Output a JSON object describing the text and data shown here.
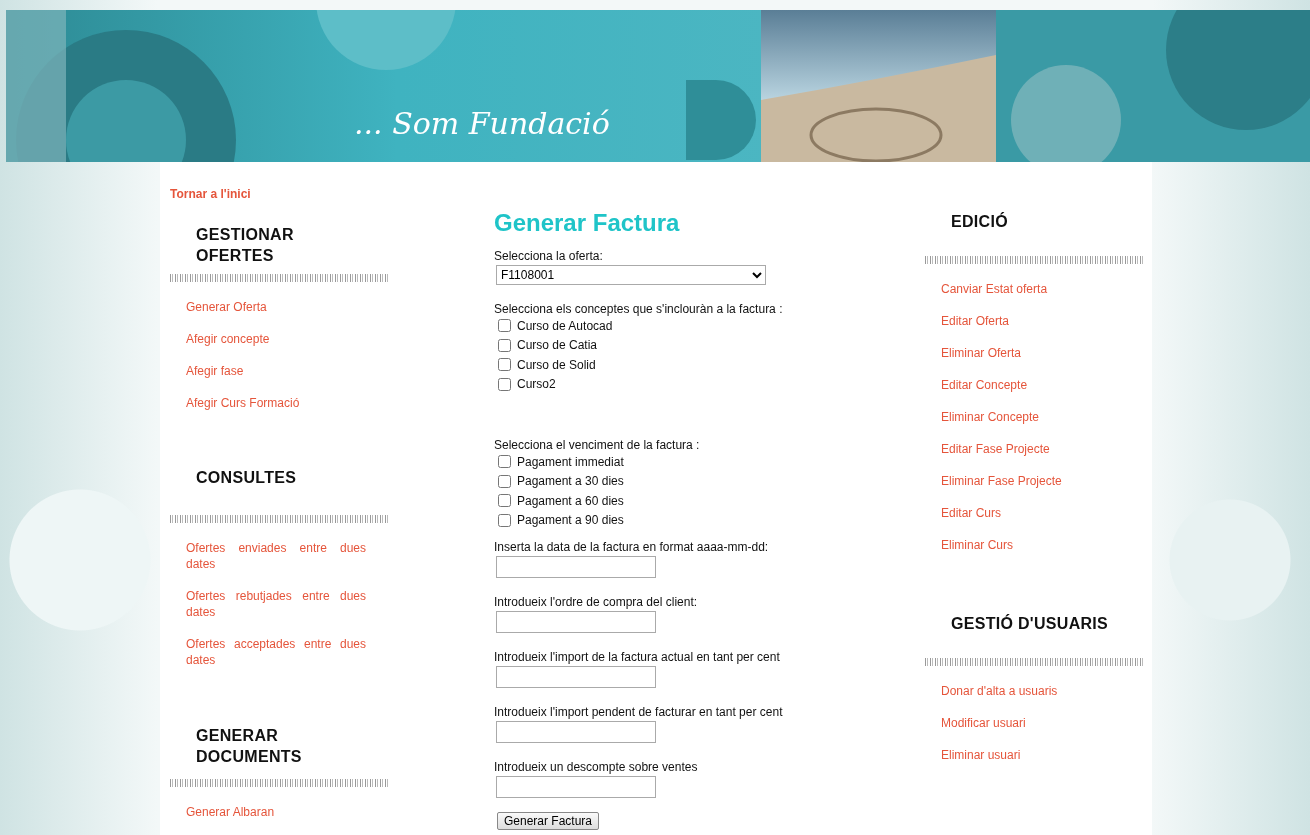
{
  "banner": {
    "slogan": "... Som Fundació"
  },
  "back_link": "Tornar a l'inici",
  "left_sections": [
    {
      "title": "GESTIONAR OFERTES",
      "links": [
        "Generar Oferta",
        "Afegir concepte",
        "Afegir fase",
        "Afegir Curs Formació"
      ]
    },
    {
      "title": "CONSULTES",
      "links": [
        "Ofertes enviades entre dues dates",
        "Ofertes rebutjades entre dues dates",
        "Ofertes acceptades entre dues dates"
      ]
    },
    {
      "title": "GENERAR DOCUMENTS",
      "links": [
        "Generar Albaran"
      ]
    }
  ],
  "form": {
    "title": "Generar Factura",
    "offer_label": "Selecciona la oferta:",
    "offer_value": "F1108001",
    "concepts_label": "Selecciona els conceptes que s'inclouràn a la factura :",
    "concepts": [
      {
        "label": "Curso de Autocad",
        "checked": false
      },
      {
        "label": "Curso de Catia",
        "checked": false
      },
      {
        "label": "Curso de Solid",
        "checked": false
      },
      {
        "label": "Curso2",
        "checked": false
      }
    ],
    "due_label": "Selecciona el venciment de la factura :",
    "due_options": [
      {
        "label": "Pagament immediat",
        "checked": false
      },
      {
        "label": "Pagament a 30 dies",
        "checked": false
      },
      {
        "label": "Pagament a 60 dies",
        "checked": false
      },
      {
        "label": "Pagament a 90 dies",
        "checked": false
      }
    ],
    "fields": [
      {
        "label": "Inserta la data de la factura en format aaaa-mm-dd:"
      },
      {
        "label": "Introdueix l'ordre de compra del client:"
      },
      {
        "label": "Introdueix l'import de la factura actual en tant per cent"
      },
      {
        "label": "Introdueix l'import pendent de facturar en tant per cent"
      },
      {
        "label": "Introdueix un descompte sobre ventes"
      }
    ],
    "submit": "Generar Factura"
  },
  "right_sections": [
    {
      "title": "EDICIÓ",
      "links": [
        "Canviar Estat oferta",
        "Editar Oferta",
        "Eliminar Oferta",
        "Editar Concepte",
        "Eliminar Concepte",
        "Editar Fase Projecte",
        "Eliminar Fase Projecte",
        "Editar Curs",
        "Eliminar Curs"
      ]
    },
    {
      "title": "GESTIÓ D'USUARIS",
      "links": [
        "Donar d'alta a usuaris",
        "Modificar usuari",
        "Eliminar usuari"
      ]
    }
  ]
}
